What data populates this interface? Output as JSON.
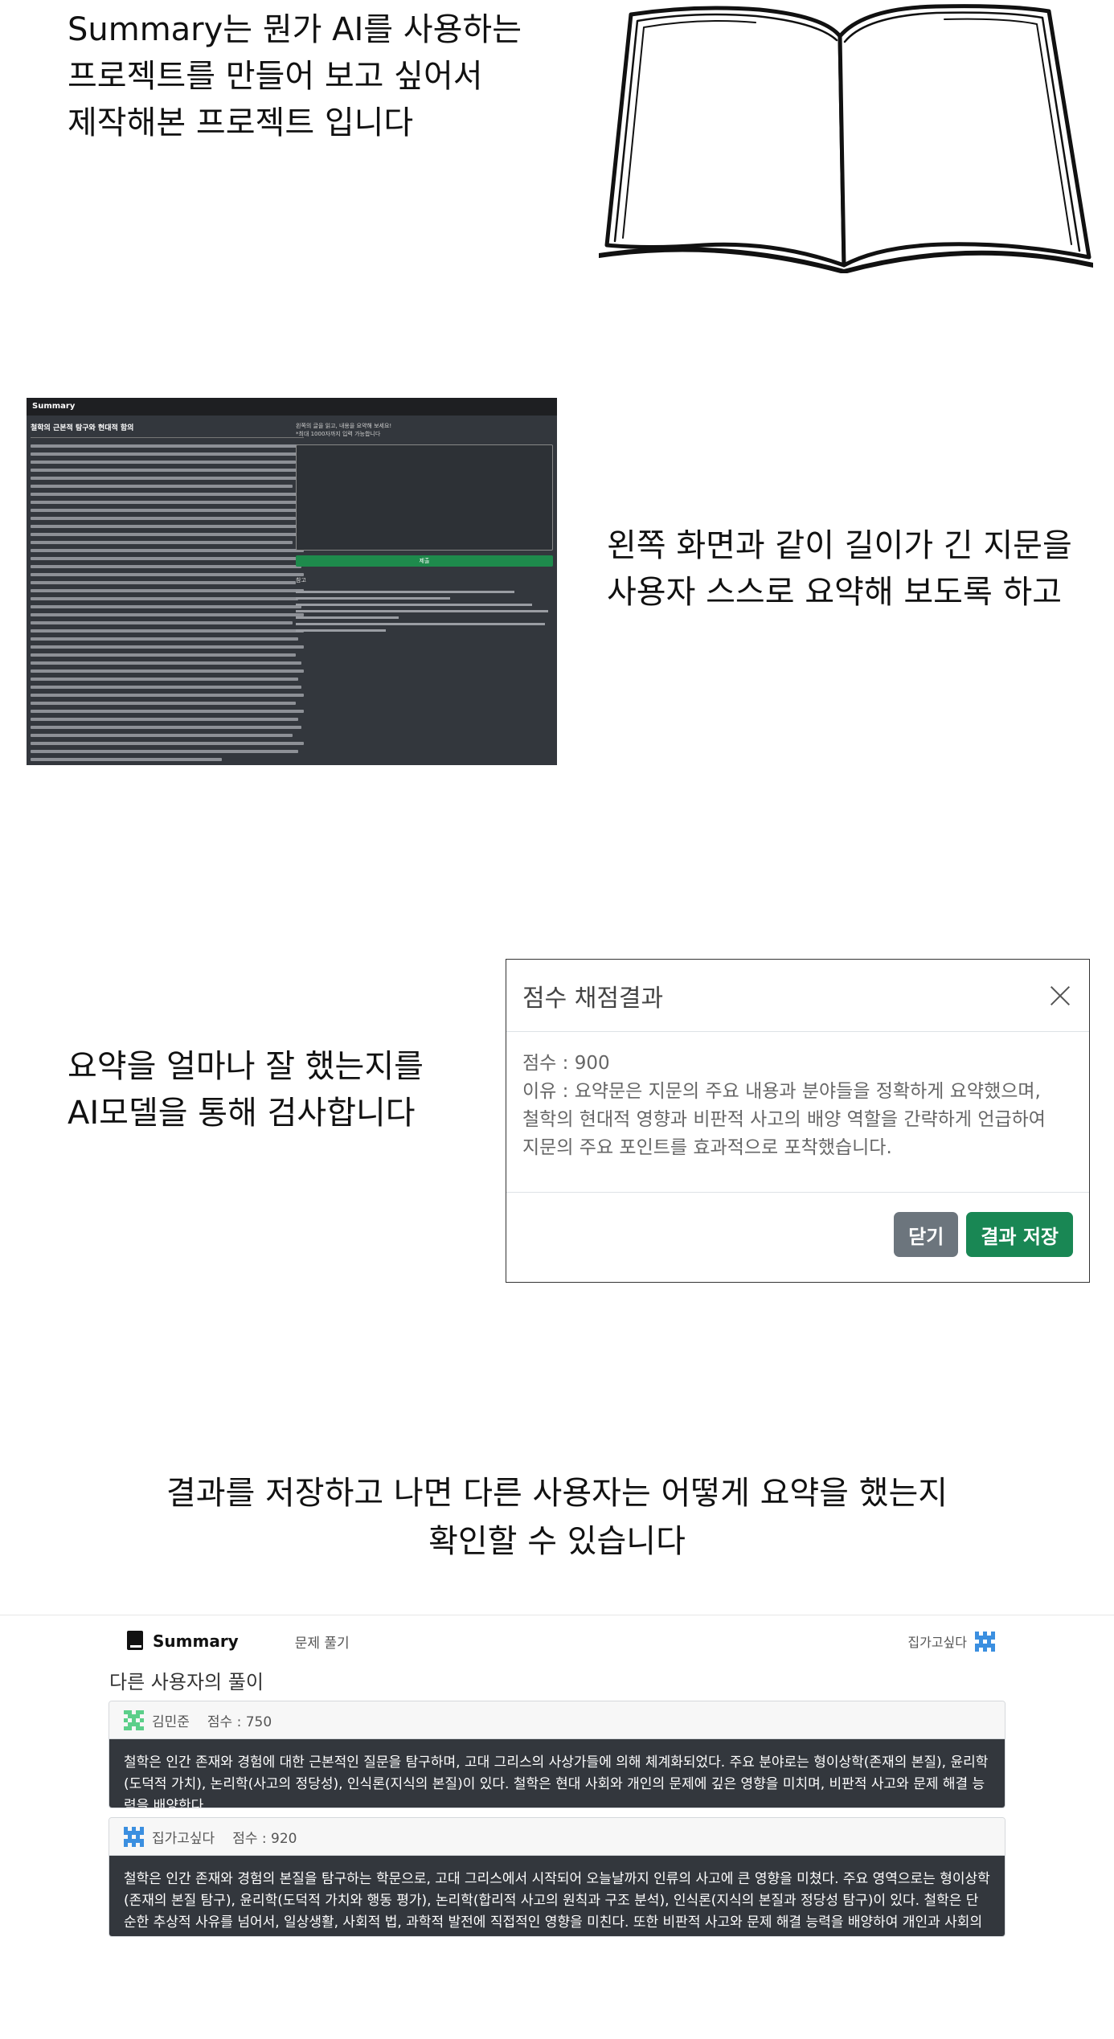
{
  "intro": {
    "line1": "Summary는 뭔가 AI를 사용하는",
    "line2": "프로젝트를 만들어 보고 싶어서",
    "line3": "제작해본 프로젝트 입니다"
  },
  "explain2": {
    "line1": "왼쪽 화면과 같이 길이가 긴 지문을",
    "line2": "사용자 스스로 요약해 보도록 하고"
  },
  "mini_screen": {
    "brand": "Summary",
    "title": "철학의 근본적 탐구와 현대적 함의",
    "note_line1": "왼쪽의 글을 읽고, 내용을 요약해 보세요!",
    "note_line2": "*최대 1000자까지 입력 가능합니다",
    "submit_label": "제출",
    "ref_title": "참고"
  },
  "explain3": {
    "line1": "요약을 얼마나 잘 했는지를",
    "line2": "AI모델을 통해 검사합니다"
  },
  "modal": {
    "title": "점수 채점결과",
    "score_line": "점수 : 900",
    "reason_line1": "이유 : 요약문은 지문의 주요 내용과 분야들을 정확하게 요약했으며,",
    "reason_line2": "철학의 현대적 영향과 비판적 사고의 배양 역할을 간략하게 언급하여",
    "reason_line3": "지문의 주요 포인트를 효과적으로 포착했습니다.",
    "close_label": "닫기",
    "save_label": "결과 저장"
  },
  "explain4": {
    "line1": "결과를 저장하고 나면 다른 사용자는 어떻게 요약을 했는지",
    "line2": "확인할 수 있습니다"
  },
  "app": {
    "brand": "Summary",
    "nav_link": "문제 풀기",
    "username": "집가고싶다",
    "section_title": "다른 사용자의 풀이",
    "colors": {
      "avatar_green": "#5ccf8a",
      "avatar_blue": "#3b8fe0",
      "card_dark": "#33373d"
    },
    "solutions": [
      {
        "user": "김민준",
        "score": "점수 : 750",
        "text": "철학은 인간 존재와 경험에 대한 근본적인 질문을 탐구하며, 고대 그리스의 사상가들에 의해 체계화되었다. 주요 분야로는 형이상학(존재의 본질), 윤리학(도덕적 가치), 논리학(사고의 정당성), 인식론(지식의 본질)이 있다. 철학은 현대 사회와 개인의 문제에 깊은 영향을 미치며, 비판적 사고와 문제 해결 능력을 배양한다."
      },
      {
        "user": "집가고싶다",
        "score": "점수 : 920",
        "text": "철학은 인간 존재와 경험의 본질을 탐구하는 학문으로, 고대 그리스에서 시작되어 오늘날까지 인류의 사고에 큰 영향을 미쳤다. 주요 영역으로는 형이상학(존재의 본질 탐구), 윤리학(도덕적 가치와 행동 평가), 논리학(합리적 사고의 원칙과 구조 분석), 인식론(지식의 본질과 정당성 탐구)이 있다. 철학은 단순한 추상적 사유를 넘어서, 일상생활, 사회적 법, 과학적 발전에 직접적인 영향을 미친다. 또한 비판적 사고와 문제 해결 능력을 배양하여 개인과 사회의 발전에 기여한다."
      }
    ]
  }
}
